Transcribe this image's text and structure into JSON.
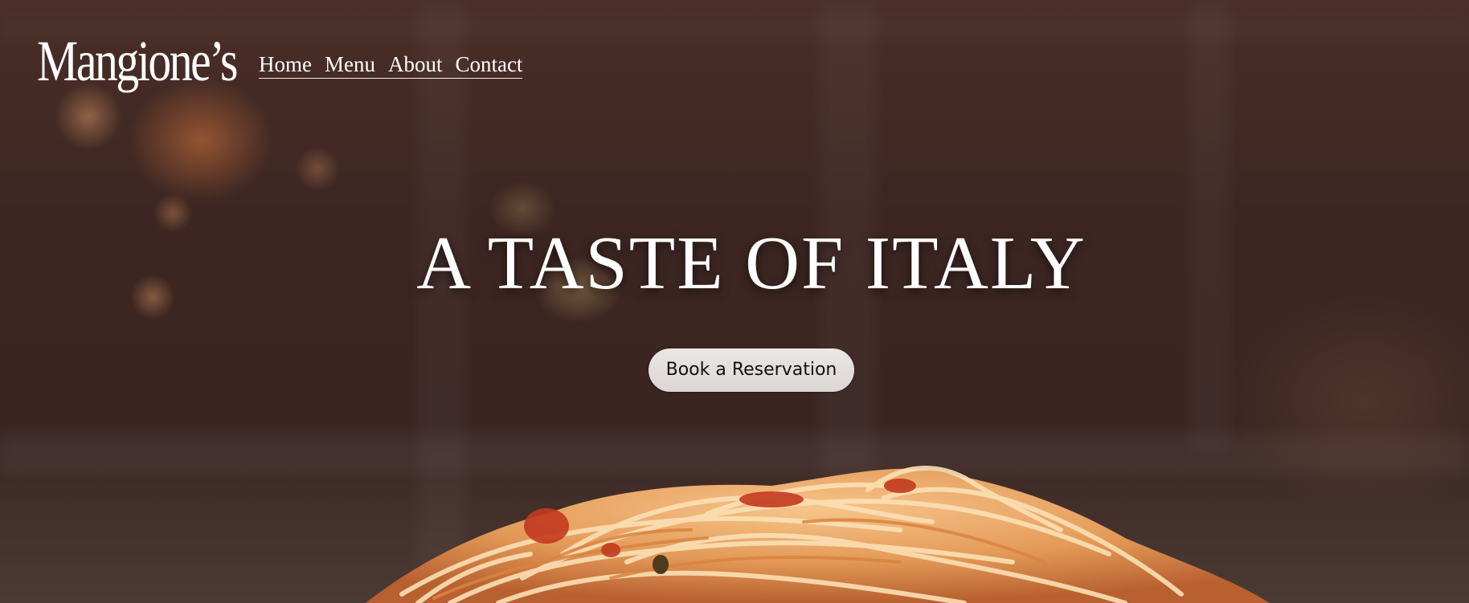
{
  "brand": {
    "logo_text": "Mangione’s"
  },
  "nav": {
    "items": [
      {
        "label": "Home"
      },
      {
        "label": "Menu"
      },
      {
        "label": "About"
      },
      {
        "label": "Contact"
      }
    ]
  },
  "hero": {
    "headline": "A TASTE OF ITALY",
    "cta_label": "Book a Reservation",
    "image_subject": "plate-of-spaghetti-with-tomato-sauce"
  },
  "colors": {
    "text": "#ffffff",
    "button_bg": "#e6e2e1",
    "button_text": "#111111",
    "background_dark": "#3b2420"
  }
}
